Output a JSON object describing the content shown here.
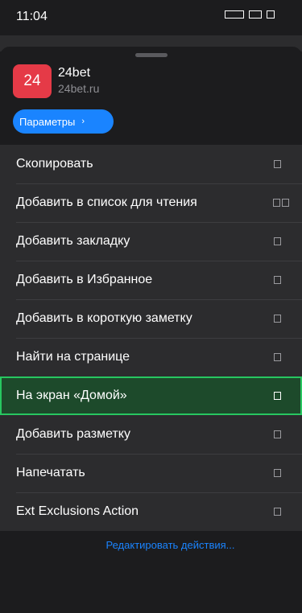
{
  "status_bar": {
    "time": "11:04"
  },
  "site": {
    "icon_text": "24",
    "icon_color": "#e53a47",
    "title": "24bet",
    "url": "24bet.ru"
  },
  "params_button": {
    "label": "Параметры",
    "chevron": "›"
  },
  "menu": {
    "items": [
      {
        "label": "Скопировать",
        "icon": "copy-icon"
      },
      {
        "label": "Добавить в список для чтения",
        "icon": "reading-list-icon"
      },
      {
        "label": "Добавить закладку",
        "icon": "bookmark-icon"
      },
      {
        "label": "Добавить в Избранное",
        "icon": "favorites-icon"
      },
      {
        "label": "Добавить в короткую заметку",
        "icon": "quick-note-icon"
      },
      {
        "label": "Найти на странице",
        "icon": "find-icon"
      },
      {
        "label": "На экран «Домой»",
        "icon": "add-home-icon",
        "highlighted": true
      },
      {
        "label": "Добавить разметку",
        "icon": "markup-icon"
      },
      {
        "label": "Напечатать",
        "icon": "print-icon"
      },
      {
        "label": "Ext Exclusions Action",
        "icon": "extension-icon"
      }
    ]
  },
  "edit_actions": {
    "label": "Редактировать действия..."
  },
  "colors": {
    "accent": "#1a84ff",
    "highlight_border": "#27c760",
    "highlight_fill": "#1d4a2b"
  }
}
